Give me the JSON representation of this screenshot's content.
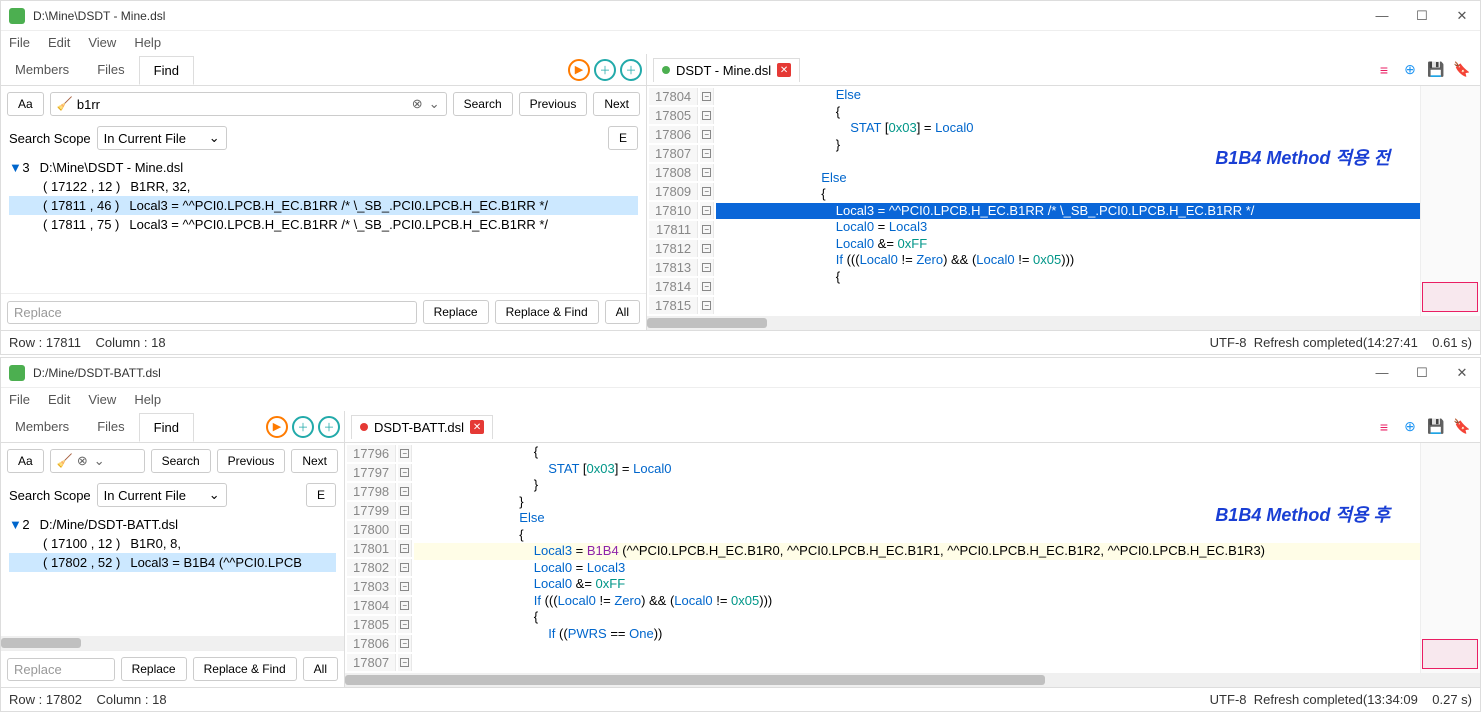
{
  "win1": {
    "title": "D:\\Mine\\DSDT - Mine.dsl",
    "menu": [
      "File",
      "Edit",
      "View",
      "Help"
    ],
    "tabs": [
      "Members",
      "Files",
      "Find"
    ],
    "activeTab": 2,
    "search": {
      "aa": "Aa",
      "value": "b1rr",
      "search": "Search",
      "prev": "Previous",
      "next": "Next",
      "scope": "Search Scope",
      "scopeVal": "In Current File",
      "e": "E"
    },
    "resHeader": {
      "count": "3",
      "path": "D:\\Mine\\DSDT - Mine.dsl"
    },
    "results": [
      {
        "loc": "( 17122 , 12 )",
        "text": "B1RR,   32,",
        "sel": false
      },
      {
        "loc": "( 17811 , 46 )",
        "text": "Local3 = ^^PCI0.LPCB.H_EC.B1RR /* \\_SB_.PCI0.LPCB.H_EC.B1RR */",
        "sel": true
      },
      {
        "loc": "( 17811 , 75 )",
        "text": "Local3 = ^^PCI0.LPCB.H_EC.B1RR /* \\_SB_.PCI0.LPCB.H_EC.B1RR */",
        "sel": false
      }
    ],
    "replace": {
      "ph": "Replace",
      "btn": "Replace",
      "rf": "Replace & Find",
      "all": "All"
    },
    "status": {
      "row": "Row : 17811",
      "col": "Column : 18",
      "enc": "UTF-8",
      "msg": "Refresh completed(14:27:41",
      "time": "0.61 s)"
    },
    "file": {
      "name": "DSDT - Mine.dsl"
    },
    "annotation": "B1B4 Method 적용 전",
    "lines": [
      {
        "n": "17804",
        "c": "                                Else"
      },
      {
        "n": "17805",
        "c": "                                {"
      },
      {
        "n": "17806",
        "c": "                                    STAT [0x03] = Local0"
      },
      {
        "n": "17807",
        "c": "                                }"
      },
      {
        "n": "17808",
        "c": ""
      },
      {
        "n": "17809",
        "c": "                            Else"
      },
      {
        "n": "17810",
        "c": "                            {"
      },
      {
        "n": "17811",
        "c": "                                Local3 = ^^PCI0.LPCB.H_EC.B1RR /* \\_SB_.PCI0.LPCB.H_EC.B1RR */",
        "hl": true
      },
      {
        "n": "17812",
        "c": "                                Local0 = Local3"
      },
      {
        "n": "17813",
        "c": "                                Local0 &= 0xFF"
      },
      {
        "n": "17814",
        "c": "                                If (((Local0 != Zero) && (Local0 != 0x05)))"
      },
      {
        "n": "17815",
        "c": "                                {"
      }
    ]
  },
  "win2": {
    "title": "D:/Mine/DSDT-BATT.dsl",
    "menu": [
      "File",
      "Edit",
      "View",
      "Help"
    ],
    "tabs": [
      "Members",
      "Files",
      "Find"
    ],
    "activeTab": 2,
    "search": {
      "aa": "Aa",
      "search": "Search",
      "prev": "Previous",
      "next": "Next",
      "scope": "Search Scope",
      "scopeVal": "In Current File",
      "e": "E"
    },
    "resHeader": {
      "count": "2",
      "path": "D:/Mine/DSDT-BATT.dsl"
    },
    "results": [
      {
        "loc": "( 17100 , 12 )",
        "text": "B1R0,   8,",
        "sel": false
      },
      {
        "loc": "( 17802 , 52 )",
        "text": "Local3 = B1B4 (^^PCI0.LPCB",
        "sel": true
      }
    ],
    "replace": {
      "ph": "Replace",
      "btn": "Replace",
      "rf": "Replace & Find",
      "all": "All"
    },
    "status": {
      "row": "Row : 17802",
      "col": "Column : 18",
      "enc": "UTF-8",
      "msg": "Refresh completed(13:34:09",
      "time": "0.27 s)"
    },
    "file": {
      "name": "DSDT-BATT.dsl"
    },
    "annotation": "B1B4 Method 적용 후",
    "lines": [
      {
        "n": "17796",
        "c": "                                {"
      },
      {
        "n": "17797",
        "c": "                                    STAT [0x03] = Local0"
      },
      {
        "n": "17798",
        "c": "                                }"
      },
      {
        "n": "17799",
        "c": "                            }"
      },
      {
        "n": "17800",
        "c": "                            Else"
      },
      {
        "n": "17801",
        "c": "                            {"
      },
      {
        "n": "17802",
        "c": "                                Local3 = B1B4 (^^PCI0.LPCB.H_EC.B1R0, ^^PCI0.LPCB.H_EC.B1R1, ^^PCI0.LPCB.H_EC.B1R2, ^^PCI0.LPCB.H_EC.B1R3)",
        "hlw": true
      },
      {
        "n": "17803",
        "c": "                                Local0 = Local3"
      },
      {
        "n": "17804",
        "c": "                                Local0 &= 0xFF"
      },
      {
        "n": "17805",
        "c": "                                If (((Local0 != Zero) && (Local0 != 0x05)))"
      },
      {
        "n": "17806",
        "c": "                                {"
      },
      {
        "n": "17807",
        "c": "                                    If ((PWRS == One))"
      }
    ]
  }
}
